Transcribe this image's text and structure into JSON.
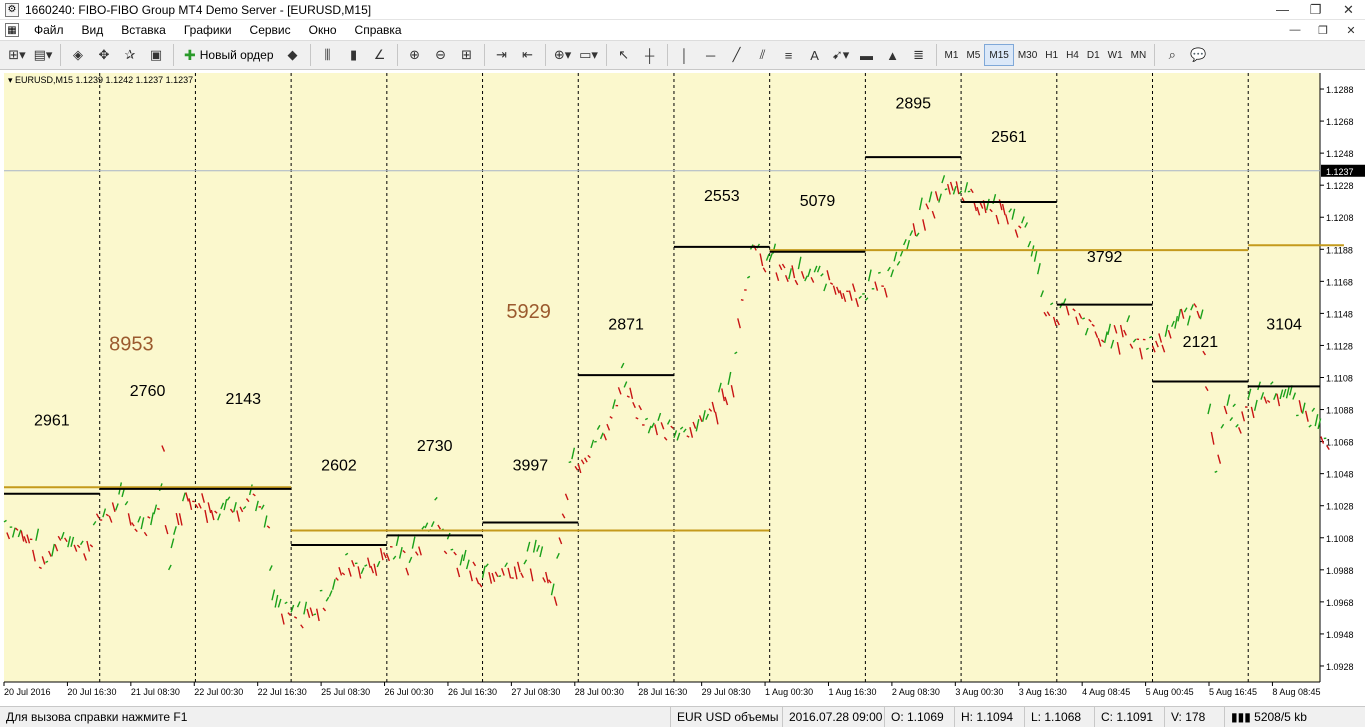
{
  "window": {
    "title": "1660240: FIBO-FIBO Group MT4 Demo Server - [EURUSD,M15]",
    "minimize": "—",
    "maximize": "❐",
    "close": "✕"
  },
  "menu": {
    "items": [
      "Файл",
      "Вид",
      "Вставка",
      "Графики",
      "Сервис",
      "Окно",
      "Справка"
    ],
    "mdi_minimize": "—",
    "mdi_restore": "❐",
    "mdi_close": "✕"
  },
  "toolbar": {
    "new_order_label": "Новый ордер",
    "timeframes": [
      "M1",
      "M5",
      "M15",
      "M30",
      "H1",
      "H4",
      "D1",
      "W1",
      "MN"
    ],
    "active_timeframe": "M15"
  },
  "chart_data": {
    "type": "line",
    "symbol_header": "EURUSD,M15  1.1239 1.1242 1.1237 1.1237",
    "price_labels": [
      "1.1288",
      "1.1268",
      "1.1248",
      "1.1228",
      "1.1208",
      "1.1188",
      "1.1168",
      "1.1148",
      "1.1128",
      "1.1108",
      "1.1088",
      "1.1068",
      "1.1048",
      "1.1028",
      "1.1008",
      "1.0988",
      "1.0968",
      "1.0948",
      "1.0928"
    ],
    "current_price": "1.1237",
    "ylim": [
      1.0918,
      1.1298
    ],
    "time_labels": [
      "20 Jul 2016",
      "20 Jul 16:30",
      "21 Jul 08:30",
      "22 Jul 00:30",
      "22 Jul 16:30",
      "25 Jul 08:30",
      "26 Jul 00:30",
      "26 Jul 16:30",
      "27 Jul 08:30",
      "28 Jul 00:30",
      "28 Jul 16:30",
      "29 Jul 08:30",
      "1 Aug 00:30",
      "1 Aug 16:30",
      "2 Aug 08:30",
      "3 Aug 00:30",
      "3 Aug 16:30",
      "4 Aug 08:45",
      "5 Aug 00:45",
      "5 Aug 16:45",
      "8 Aug 08:45"
    ],
    "session_volumes": [
      {
        "label": "2961",
        "level": 1.10355,
        "label_price": 1.1078
      },
      {
        "label": "2760",
        "level": 1.10385,
        "label_price": 1.10965
      },
      {
        "label": "2143",
        "level": 1.10385,
        "label_price": 1.10915
      },
      {
        "label": "2602",
        "level": 1.10035,
        "label_price": 1.105
      },
      {
        "label": "2730",
        "level": 1.10095,
        "label_price": 1.1062
      },
      {
        "label": "3997",
        "level": 1.10175,
        "label_price": 1.105
      },
      {
        "label": "2871",
        "level": 1.11095,
        "label_price": 1.1138
      },
      {
        "label": "2553",
        "level": 1.11895,
        "label_price": 1.1218
      },
      {
        "label": "5079",
        "level": 1.11865,
        "label_price": 1.1215
      },
      {
        "label": "2895",
        "level": 1.12455,
        "label_price": 1.1276
      },
      {
        "label": "2561",
        "level": 1.12175,
        "label_price": 1.1255
      },
      {
        "label": "3792",
        "level": 1.11535,
        "label_price": 1.118
      },
      {
        "label": "2121",
        "level": 1.11055,
        "label_price": 1.1127
      },
      {
        "label": "3104",
        "level": 1.11025,
        "label_price": 1.1138
      }
    ],
    "weekly_volumes": [
      {
        "label": "8953",
        "level": 1.10395,
        "label_price": 1.1125,
        "start": 0,
        "end": 3
      },
      {
        "label": "5929",
        "level": 1.10125,
        "label_price": 1.1145,
        "start": 3,
        "end": 8
      },
      {
        "label": "",
        "level": 1.11875,
        "label_price": 0,
        "start": 8,
        "end": 13
      },
      {
        "label": "",
        "level": 1.11905,
        "label_price": 0,
        "start": 13,
        "end": 14
      }
    ],
    "price_path": [
      [
        0.0,
        1.1018
      ],
      [
        0.3,
        1.1005
      ],
      [
        0.4,
        1.099
      ],
      [
        0.6,
        1.1012
      ],
      [
        0.8,
        1.1
      ],
      [
        1.0,
        1.102
      ],
      [
        1.2,
        1.103
      ],
      [
        1.4,
        1.1015
      ],
      [
        1.6,
        1.1025
      ],
      [
        1.65,
        1.106
      ],
      [
        1.72,
        1.0985
      ],
      [
        1.8,
        1.1028
      ],
      [
        2.0,
        1.1035
      ],
      [
        2.2,
        1.1025
      ],
      [
        2.4,
        1.103
      ],
      [
        2.6,
        1.1035
      ],
      [
        2.75,
        1.101
      ],
      [
        2.8,
        1.0965
      ],
      [
        3.0,
        1.0958
      ],
      [
        3.2,
        1.0962
      ],
      [
        3.4,
        1.0975
      ],
      [
        3.6,
        1.0995
      ],
      [
        3.8,
        1.099
      ],
      [
        4.0,
        1.1
      ],
      [
        4.2,
        1.0995
      ],
      [
        4.4,
        1.101
      ],
      [
        4.5,
        1.1025
      ],
      [
        4.6,
        1.1005
      ],
      [
        4.8,
        1.099
      ],
      [
        5.0,
        1.0985
      ],
      [
        5.2,
        1.0988
      ],
      [
        5.4,
        1.0992
      ],
      [
        5.6,
        1.0995
      ],
      [
        5.75,
        1.097
      ],
      [
        5.8,
        1.1015
      ],
      [
        5.9,
        1.1055
      ],
      [
        6.1,
        1.1065
      ],
      [
        6.3,
        1.1075
      ],
      [
        6.45,
        1.111
      ],
      [
        6.6,
        1.109
      ],
      [
        6.8,
        1.1075
      ],
      [
        7.0,
        1.1072
      ],
      [
        7.2,
        1.108
      ],
      [
        7.4,
        1.1088
      ],
      [
        7.6,
        1.111
      ],
      [
        7.7,
        1.116
      ],
      [
        7.8,
        1.1185
      ],
      [
        8.0,
        1.118
      ],
      [
        8.2,
        1.1172
      ],
      [
        8.4,
        1.117
      ],
      [
        8.6,
        1.1168
      ],
      [
        8.8,
        1.1165
      ],
      [
        9.0,
        1.1162
      ],
      [
        9.2,
        1.117
      ],
      [
        9.4,
        1.1185
      ],
      [
        9.6,
        1.121
      ],
      [
        9.8,
        1.1225
      ],
      [
        9.95,
        1.1228
      ],
      [
        10.1,
        1.1222
      ],
      [
        10.3,
        1.1215
      ],
      [
        10.5,
        1.121
      ],
      [
        10.7,
        1.1195
      ],
      [
        10.8,
        1.117
      ],
      [
        10.9,
        1.1148
      ],
      [
        11.1,
        1.115
      ],
      [
        11.3,
        1.114
      ],
      [
        11.5,
        1.113
      ],
      [
        11.7,
        1.1138
      ],
      [
        11.9,
        1.1128
      ],
      [
        12.1,
        1.1135
      ],
      [
        12.3,
        1.1145
      ],
      [
        12.5,
        1.115
      ],
      [
        12.58,
        1.1085
      ],
      [
        12.65,
        1.105
      ],
      [
        12.75,
        1.109
      ],
      [
        12.9,
        1.1082
      ],
      [
        13.1,
        1.1095
      ],
      [
        13.3,
        1.11
      ],
      [
        13.5,
        1.1088
      ],
      [
        13.7,
        1.1082
      ],
      [
        13.85,
        1.107
      ]
    ]
  },
  "status": {
    "help": "Для вызова справки нажмите F1",
    "profile": "EUR USD объемы",
    "datetime": "2016.07.28 09:00",
    "open": "O: 1.1069",
    "high": "H: 1.1094",
    "low": "L: 1.1068",
    "close": "C: 1.1091",
    "volume": "V: 178",
    "traffic": "5208/5 kb"
  }
}
